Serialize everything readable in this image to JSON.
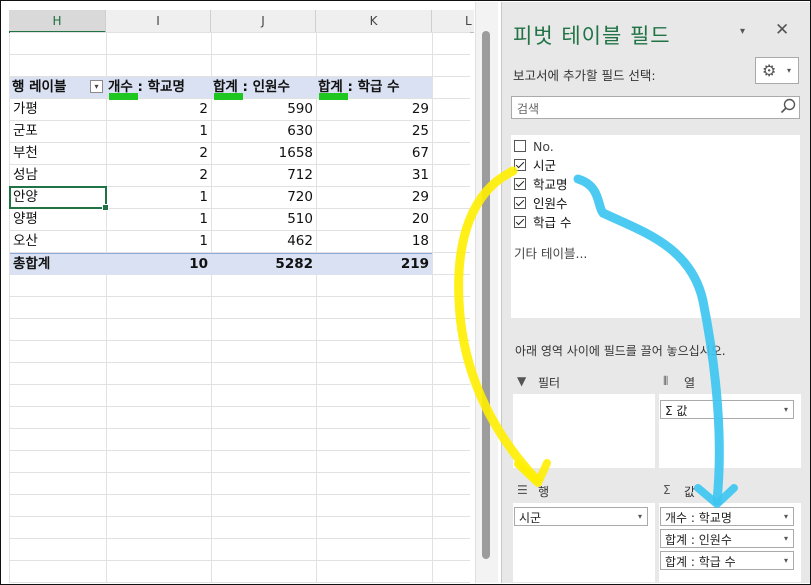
{
  "sheet": {
    "columns": [
      "H",
      "I",
      "J",
      "K",
      "L"
    ],
    "selected_column": "H",
    "header": {
      "row_label": "행 레이블",
      "col_i": "개수 : 학교명",
      "col_j": "합계 : 인원수",
      "col_k": "합계 : 학급 수",
      "filter_button": "▾"
    },
    "rows": [
      {
        "h": "가평",
        "i": "2",
        "j": "590",
        "k": "29"
      },
      {
        "h": "군포",
        "i": "1",
        "j": "630",
        "k": "25"
      },
      {
        "h": "부천",
        "i": "2",
        "j": "1658",
        "k": "67"
      },
      {
        "h": "성남",
        "i": "2",
        "j": "712",
        "k": "31"
      },
      {
        "h": "안양",
        "i": "1",
        "j": "720",
        "k": "29"
      },
      {
        "h": "양평",
        "i": "1",
        "j": "510",
        "k": "20"
      },
      {
        "h": "오산",
        "i": "1",
        "j": "462",
        "k": "18"
      }
    ],
    "total": {
      "h": "총합계",
      "i": "10",
      "j": "5282",
      "k": "219"
    },
    "active_cell_value": "안양"
  },
  "pane": {
    "title": "피벗 테이블 필드",
    "menu_arrow": "▾",
    "close": "✕",
    "choose_fields_label": "보고서에 추가할 필드 선택:",
    "gear_dropdown": "▾",
    "search_placeholder": "검색",
    "fields": [
      {
        "label": "No.",
        "checked": false
      },
      {
        "label": "시군",
        "checked": true
      },
      {
        "label": "학교명",
        "checked": true
      },
      {
        "label": "인원수",
        "checked": true
      },
      {
        "label": "학급 수",
        "checked": true
      }
    ],
    "more_tables": "기타 테이블...",
    "drag_hint": "아래 영역 사이에 필드를 끌어 놓으십시오.",
    "areas": {
      "filter": {
        "title": "필터",
        "icon": "▼",
        "items": []
      },
      "columns": {
        "title": "열",
        "icon": "⦀",
        "items": [
          "Σ 값"
        ]
      },
      "rows": {
        "title": "행",
        "icon": "☰",
        "items": [
          "시군"
        ]
      },
      "values": {
        "title": "값",
        "icon": "Σ",
        "items": [
          "개수 : 학교명",
          "합계 : 인원수",
          "합계 : 학급 수"
        ]
      }
    },
    "pill_arrow": "▾"
  },
  "colors": {
    "accent": "#217346",
    "pivot_header_bg": "#d9e1f2",
    "highlight_green": "#1fc61f",
    "arrow_yellow": "#ffee00",
    "arrow_blue": "#3ec6f0"
  }
}
